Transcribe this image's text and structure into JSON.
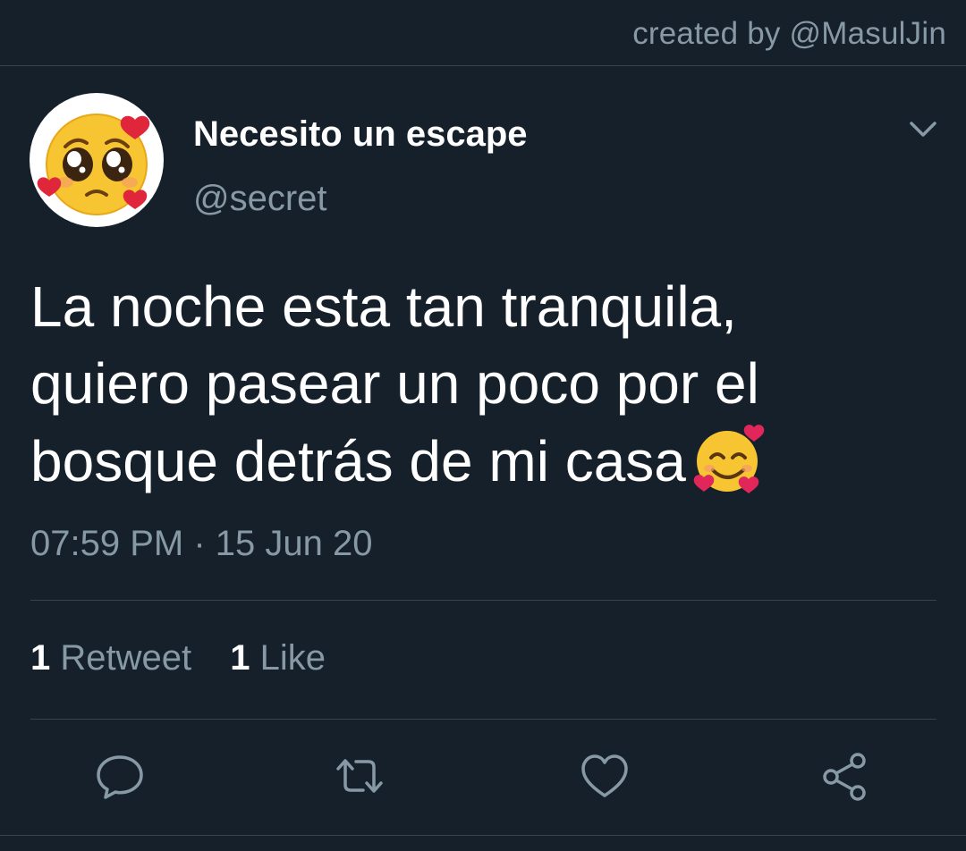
{
  "header": {
    "credit": "created by @MasulJin"
  },
  "tweet": {
    "author_name": "Necesito un escape",
    "author_handle": "@secret",
    "avatar_icon": "pleading-face-hearts-icon",
    "text_lines": [
      "La noche esta tan tranquila,",
      "quiero pasear un poco por el",
      "bosque detrás de mi casa"
    ],
    "text_emoji": "smiling-face-with-hearts-icon",
    "timestamp": "07:59 PM · 15 Jun 20"
  },
  "stats": {
    "retweets_count": "1",
    "retweets_label": "Retweet",
    "likes_count": "1",
    "likes_label": "Like"
  },
  "actions": [
    "reply-icon",
    "retweet-icon",
    "like-icon",
    "share-icon"
  ],
  "colors": {
    "background": "#15202b",
    "text_primary": "#ffffff",
    "text_secondary": "#8899a6",
    "divider": "#38444d"
  }
}
